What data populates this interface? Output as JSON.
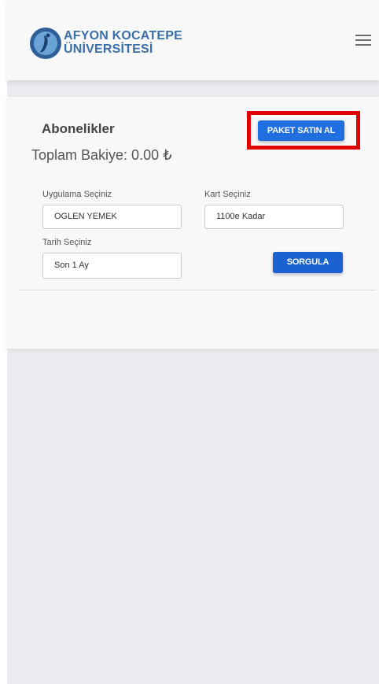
{
  "header": {
    "brand_line1": "AFYON KOCATEPE",
    "brand_line2": "ÜNİVERSİTESİ",
    "logo_icon": "university-logo-icon",
    "menu_icon": "hamburger-menu-icon"
  },
  "main": {
    "title": "Abonelikler",
    "balance": "Toplam Bakiye: 0.00 ₺",
    "buy_button": "PAKET SATIN AL",
    "query_button": "SORGULA",
    "fields": {
      "application_label": "Uygulama Seçiniz",
      "application_value": "OGLEN YEMEK",
      "card_label": "Kart Seçiniz",
      "card_value": "1100e Kadar",
      "date_label": "Tarih Seçiniz",
      "date_value": "Son 1 Ay"
    }
  },
  "colors": {
    "primary": "#1f6fe0",
    "highlight": "#e00000",
    "brand": "#3a6fa8"
  }
}
